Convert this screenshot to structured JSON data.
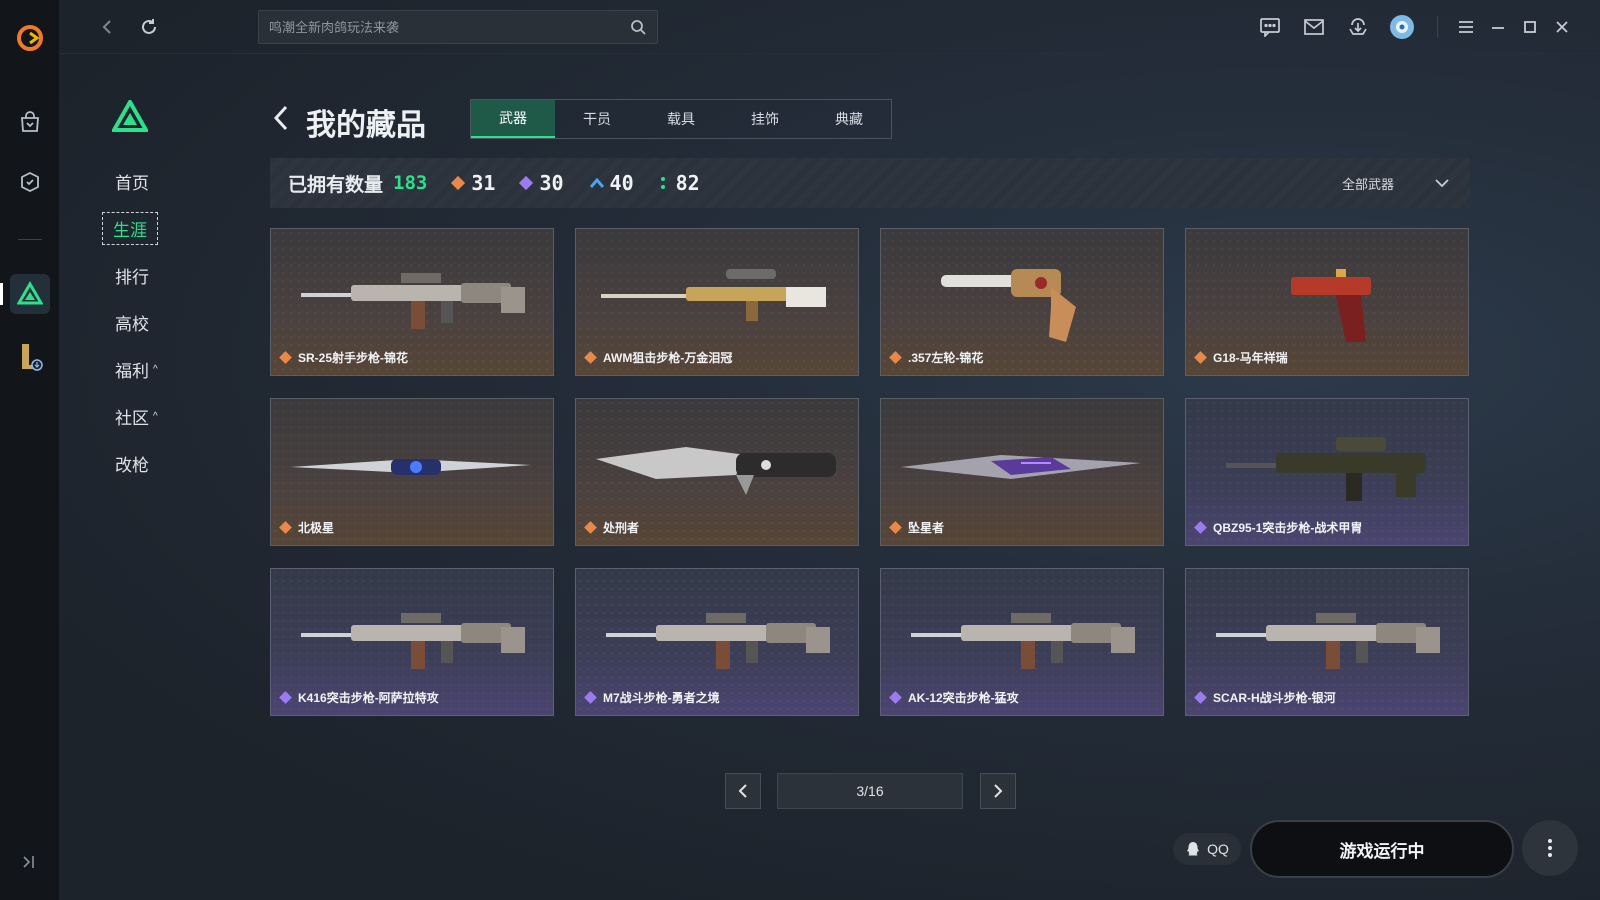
{
  "search": {
    "placeholder": "鸣潮全新肉鸽玩法来袭"
  },
  "sidebar": {
    "items": [
      {
        "label": "首页",
        "active": false
      },
      {
        "label": "生涯",
        "active": true
      },
      {
        "label": "排行",
        "active": false
      },
      {
        "label": "高校",
        "active": false
      },
      {
        "label": "福利",
        "caret": "^",
        "active": false
      },
      {
        "label": "社区",
        "caret": "^",
        "active": false
      },
      {
        "label": "改枪",
        "active": false
      }
    ]
  },
  "header": {
    "title": "我的藏品",
    "tabs": [
      {
        "label": "武器",
        "active": true
      },
      {
        "label": "干员",
        "active": false
      },
      {
        "label": "载具",
        "active": false
      },
      {
        "label": "挂饰",
        "active": false
      },
      {
        "label": "典藏",
        "active": false
      }
    ]
  },
  "stats": {
    "owned_label": "已拥有数量",
    "owned_total": "183",
    "counts": [
      {
        "value": "31",
        "color": "#e8894a",
        "icon": "orange-gem-icon"
      },
      {
        "value": "30",
        "color": "#9b7cf0",
        "icon": "purple-gem-icon"
      },
      {
        "value": "40",
        "color": "#4aa3f0",
        "icon": "blue-chevron-icon"
      },
      {
        "value": "82",
        "color": "#2fe08a",
        "icon": "green-dots-icon"
      }
    ],
    "filter_label": "全部武器"
  },
  "items": [
    {
      "name": "SR-25射手步枪-锦花",
      "rarity": "orange",
      "kind": "rifle"
    },
    {
      "name": "AWM狙击步枪-万金泪冠",
      "rarity": "orange",
      "kind": "sniper"
    },
    {
      "name": ".357左轮-锦花",
      "rarity": "orange",
      "kind": "revolver"
    },
    {
      "name": "G18-马年祥瑞",
      "rarity": "orange",
      "kind": "pistol"
    },
    {
      "name": "北极星",
      "rarity": "orange",
      "kind": "knife"
    },
    {
      "name": "处刑者",
      "rarity": "orange",
      "kind": "machete"
    },
    {
      "name": "坠星者",
      "rarity": "orange",
      "kind": "blade"
    },
    {
      "name": "QBZ95-1突击步枪-战术甲胄",
      "rarity": "purple",
      "kind": "bullpup"
    },
    {
      "name": "K416突击步枪-阿萨拉特攻",
      "rarity": "purple",
      "kind": "rifle"
    },
    {
      "name": "M7战斗步枪-勇者之境",
      "rarity": "purple",
      "kind": "rifle"
    },
    {
      "name": "AK-12突击步枪-猛攻",
      "rarity": "purple",
      "kind": "rifle"
    },
    {
      "name": "SCAR-H战斗步枪-银河",
      "rarity": "purple",
      "kind": "rifle"
    }
  ],
  "pager": {
    "label": "3/16"
  },
  "footer": {
    "qq_label": "QQ",
    "play_label": "游戏运行中"
  },
  "colors": {
    "accent": "#2fe08a",
    "orange": "#e8894a",
    "purple": "#9b7cf0"
  }
}
